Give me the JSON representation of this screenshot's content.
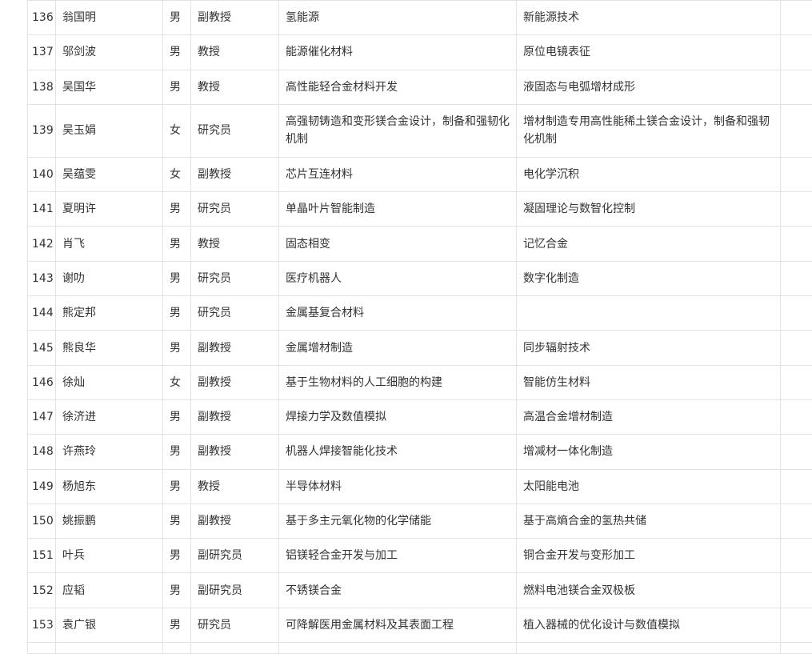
{
  "table": {
    "rows": [
      {
        "id": "136",
        "name": "翁国明",
        "gender": "男",
        "title": "副教授",
        "direction1": "氢能源",
        "direction2": "新能源技术"
      },
      {
        "id": "137",
        "name": "邬剑波",
        "gender": "男",
        "title": "教授",
        "direction1": "能源催化材料",
        "direction2": "原位电镜表征"
      },
      {
        "id": "138",
        "name": "吴国华",
        "gender": "男",
        "title": "教授",
        "direction1": "高性能轻合金材料开发",
        "direction2": "液固态与电弧增材成形"
      },
      {
        "id": "139",
        "name": "吴玉娟",
        "gender": "女",
        "title": "研究员",
        "direction1": "高强韧铸造和变形镁合金设计，制备和强韧化机制",
        "direction2": "增材制造专用高性能稀土镁合金设计，制备和强韧化机制"
      },
      {
        "id": "140",
        "name": "吴蕴雯",
        "gender": "女",
        "title": "副教授",
        "direction1": "芯片互连材料",
        "direction2": "电化学沉积"
      },
      {
        "id": "141",
        "name": "夏明许",
        "gender": "男",
        "title": "研究员",
        "direction1": "单晶叶片智能制造",
        "direction2": "凝固理论与数智化控制"
      },
      {
        "id": "142",
        "name": "肖飞",
        "gender": "男",
        "title": "教授",
        "direction1": "固态相变",
        "direction2": "记忆合金"
      },
      {
        "id": "143",
        "name": "谢叻",
        "gender": "男",
        "title": "研究员",
        "direction1": "医疗机器人",
        "direction2": "数字化制造"
      },
      {
        "id": "144",
        "name": "熊定邦",
        "gender": "男",
        "title": "研究员",
        "direction1": "金属基复合材料",
        "direction2": ""
      },
      {
        "id": "145",
        "name": "熊良华",
        "gender": "男",
        "title": "副教授",
        "direction1": "金属增材制造",
        "direction2": "同步辐射技术"
      },
      {
        "id": "146",
        "name": "徐灿",
        "gender": "女",
        "title": "副教授",
        "direction1": "基于生物材料的人工细胞的构建",
        "direction2": "智能仿生材料"
      },
      {
        "id": "147",
        "name": "徐济进",
        "gender": "男",
        "title": "副教授",
        "direction1": "焊接力学及数值模拟",
        "direction2": "高温合金增材制造"
      },
      {
        "id": "148",
        "name": "许燕玲",
        "gender": "男",
        "title": "副教授",
        "direction1": "机器人焊接智能化技术",
        "direction2": "增减材一体化制造"
      },
      {
        "id": "149",
        "name": "杨旭东",
        "gender": "男",
        "title": "教授",
        "direction1": "半导体材料",
        "direction2": "太阳能电池"
      },
      {
        "id": "150",
        "name": "姚振鹏",
        "gender": "男",
        "title": "副教授",
        "direction1": "基于多主元氧化物的化学储能",
        "direction2": "基于高熵合金的氢热共储"
      },
      {
        "id": "151",
        "name": "叶兵",
        "gender": "男",
        "title": "副研究员",
        "direction1": "铝镁轻合金开发与加工",
        "direction2": "铜合金开发与变形加工"
      },
      {
        "id": "152",
        "name": "应韬",
        "gender": "男",
        "title": "副研究员",
        "direction1": "不锈镁合金",
        "direction2": "燃料电池镁合金双极板"
      },
      {
        "id": "153",
        "name": "袁广银",
        "gender": "男",
        "title": "研究员",
        "direction1": "可降解医用金属材料及其表面工程",
        "direction2": "植入器械的优化设计与数值模拟"
      }
    ]
  }
}
